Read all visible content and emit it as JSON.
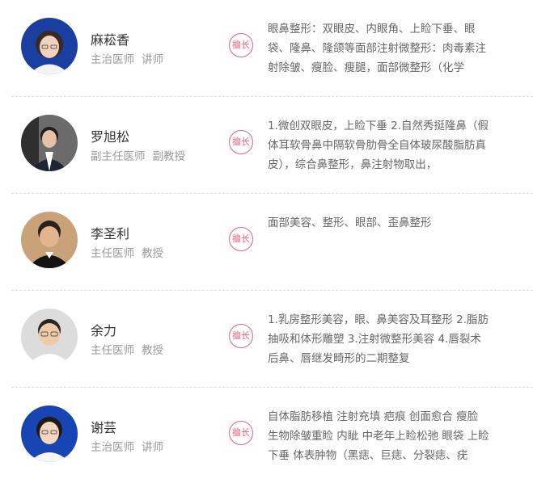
{
  "doctors": [
    {
      "name": "麻菘香",
      "position": "主治医师",
      "academic": "讲师",
      "badge": "擅长",
      "expertise": "眼鼻整形：双眼皮、内眼角、上睑下垂、眼袋、隆鼻、隆颌等面部注射微整形：肉毒素注射除皱、瘦脸、瘦腿，面部微整形（化学"
    },
    {
      "name": "罗旭松",
      "position": "副主任医师",
      "academic": "副教授",
      "badge": "擅长",
      "expertise": "1.微创双眼皮，上睑下垂 2.自然秀挺隆鼻（假体耳软骨鼻中隔软骨肋骨全自体玻尿酸脂肪真皮），综合鼻整形，鼻注射物取出，"
    },
    {
      "name": "李圣利",
      "position": "主任医师",
      "academic": "教授",
      "badge": "擅长",
      "expertise": "面部美容、整形、眼部、歪鼻整形"
    },
    {
      "name": "余力",
      "position": "主任医师",
      "academic": "教授",
      "badge": "擅长",
      "expertise": "1.乳房整形美容，眼、鼻美容及耳整形 2.脂肪抽吸和体形雕塑 3.注射微整形美容 4.唇裂术后鼻、唇继发畸形的二期整复"
    },
    {
      "name": "谢芸",
      "position": "主治医师",
      "academic": "讲师",
      "badge": "擅长",
      "expertise": "自体脂肪移植 注射充填 疤痕 创面愈合 瘦脸 生物除皱重睑 内眦 中老年上睑松弛 眼袋 上睑下垂 体表肿物（黑痣、巨痣、分裂痣、疣"
    }
  ],
  "colors": {
    "badge": "#e5637f",
    "name": "#333333",
    "title": "#9a9a9a",
    "expertise": "#666666",
    "divider": "#dddddd"
  }
}
